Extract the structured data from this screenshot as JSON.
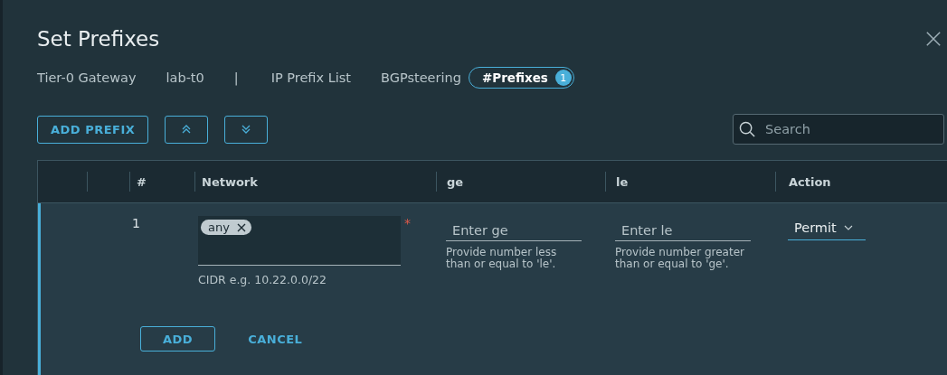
{
  "dialog": {
    "title": "Set Prefixes",
    "breadcrumb": [
      "Tier-0 Gateway",
      "lab-t0",
      "|",
      "IP Prefix List",
      "BGPsteering"
    ],
    "prefixes_tab": {
      "label": "#Prefixes",
      "count": "1",
      "selected": true
    }
  },
  "toolbar": {
    "add_button": "ADD PREFIX",
    "search": {
      "placeholder": "Search"
    }
  },
  "table": {
    "columns": [
      "#",
      "Network",
      "ge",
      "le",
      "Action"
    ],
    "rows": [
      {
        "number": "1",
        "editing": true,
        "network": {
          "tags": [
            "any"
          ],
          "required_mark": "*",
          "hint": "CIDR e.g. 10.22.0.0/22"
        },
        "ge": {
          "placeholder": "Enter ge",
          "hint": "Provide number less than or equal to 'le'."
        },
        "le": {
          "placeholder": "Enter le",
          "hint": "Provide number greater than or equal to 'ge'."
        },
        "action": "Permit",
        "buttons": [
          {
            "label": "ADD",
            "kind": "outline"
          },
          {
            "label": "CANCEL",
            "kind": "flat"
          }
        ]
      }
    ]
  }
}
